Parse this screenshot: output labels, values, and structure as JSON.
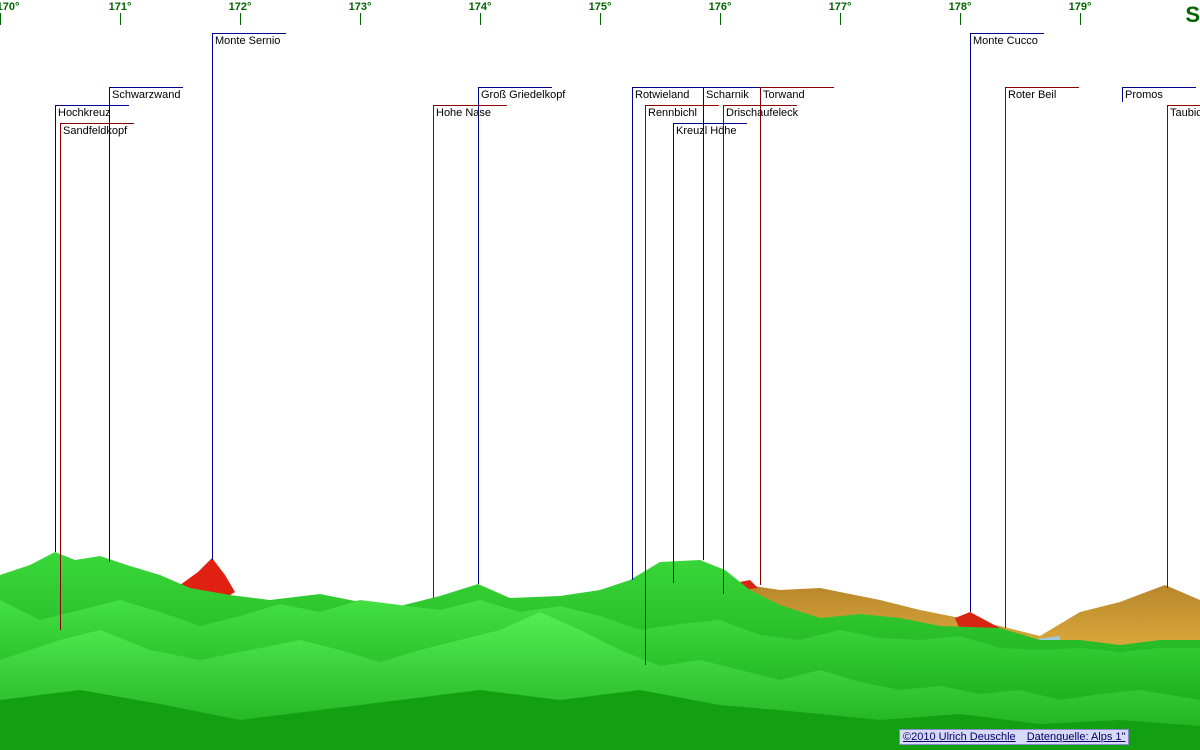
{
  "degree_axis": {
    "labels": [
      "170°",
      "171°",
      "172°",
      "173°",
      "174°",
      "175°",
      "176°",
      "177°",
      "178°",
      "179°"
    ],
    "compass_letter": "S",
    "color": "#006400"
  },
  "peaks": [
    {
      "name": "Monte Sernio",
      "color": "blue"
    },
    {
      "name": "Schwarzwand",
      "color": "blue"
    },
    {
      "name": "Hochkreuz",
      "color": "blue"
    },
    {
      "name": "Sandfeldkopf",
      "color": "darkred"
    },
    {
      "name": "Groß Griedelkopf",
      "color": "blue"
    },
    {
      "name": "Hohe Nase",
      "color": "darkred"
    },
    {
      "name": "Rotwieland",
      "color": "blue"
    },
    {
      "name": "Scharnik",
      "color": "blue"
    },
    {
      "name": "Torwand",
      "color": "darkred"
    },
    {
      "name": "Rennbichl",
      "color": "darkred"
    },
    {
      "name": "Drischaufeleck",
      "color": "darkred"
    },
    {
      "name": "Kreuzl Höhe",
      "color": "blue"
    },
    {
      "name": "Monte Cucco",
      "color": "blue"
    },
    {
      "name": "Roter Beil",
      "color": "darkred"
    },
    {
      "name": "Promos",
      "color": "blue"
    },
    {
      "name": "Taubichl",
      "color": "darkred"
    }
  ],
  "footer": {
    "copyright": "©2010 Ulrich Deuschle",
    "source": "Datenquelle: Alps 1\""
  },
  "colors": {
    "green_light": "#33dd33",
    "green_dark": "#119911",
    "red_peak": "#e02010",
    "orange_far": "#c8961e",
    "line_blue": "#00008b",
    "line_red": "#8b0000"
  }
}
